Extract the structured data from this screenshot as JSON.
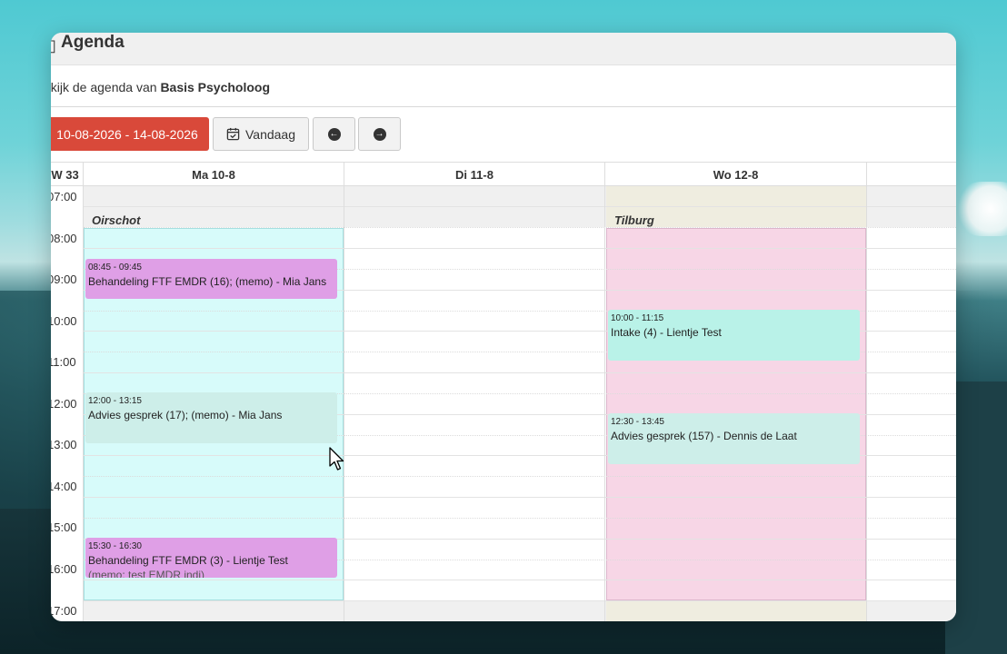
{
  "app": {
    "title": "Agenda"
  },
  "subtitle": {
    "prefix": "ekijk de agenda van",
    "name": "Basis Psycholoog"
  },
  "toolbar": {
    "range_label": "10-08-2026 - 14-08-2026",
    "today_label": "Vandaag"
  },
  "calendar": {
    "week_label": "W 33",
    "days": [
      "Ma 10-8",
      "Di 11-8",
      "Wo 12-8"
    ],
    "times": [
      "07:00",
      "08:00",
      "09:00",
      "10:00",
      "11:00",
      "12:00",
      "13:00",
      "14:00",
      "15:00",
      "16:00",
      "17:00"
    ],
    "locations": {
      "mon": "Oirschot",
      "wed": "Tilburg"
    },
    "events": {
      "mon_1": {
        "time": "08:45 - 09:45",
        "title": "Behandeling FTF EMDR (16); (memo) - Mia Jans",
        "color": "#df9fe6"
      },
      "mon_2": {
        "time": "12:00 - 13:15",
        "title": "Advies gesprek (17); (memo) - Mia Jans",
        "color": "#cdeee9"
      },
      "mon_3": {
        "time": "15:30 - 16:30",
        "title": "Behandeling FTF EMDR (3) - Lientje Test",
        "overflow": "(memo: test EMDR indi)",
        "color": "#df9fe6"
      },
      "wed_1": {
        "time": "10:00 - 11:15",
        "title": "Intake (4) - Lientje Test",
        "color": "#b9f2e8"
      },
      "wed_2": {
        "time": "12:30 - 13:45",
        "title": "Advies gesprek (157) - Dennis de Laat",
        "color": "#cdeee9"
      }
    },
    "colors": {
      "mon_band": "#d7fbfa",
      "wed_band": "#f7d6e6",
      "wed_offhours": "#efede0",
      "offhours": "#f0f0f0",
      "range_button": "#d9493a"
    }
  }
}
